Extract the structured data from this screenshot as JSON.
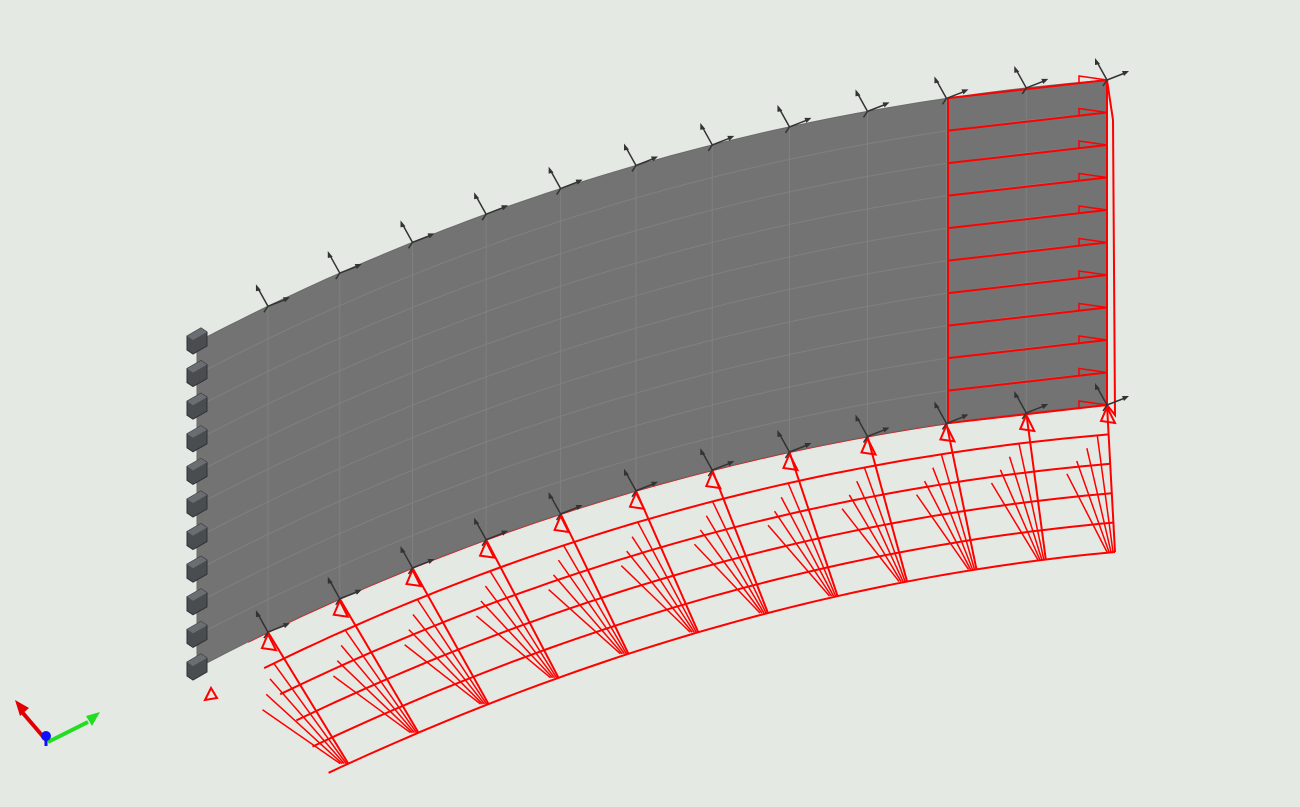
{
  "viewport": {
    "background": "#e5e9e4",
    "shell_color": "#737373",
    "shell_line_color": "#808080",
    "load_color": "#ff0000",
    "support_color": "#4a4d50",
    "triad_color": "#333333"
  },
  "model": {
    "shape": "curved-shell-panel",
    "rows": 10,
    "columns": 12,
    "support_count": 11,
    "loads": [
      "edge-load-red",
      "surface-pressure-red"
    ]
  },
  "triad": {
    "axes": [
      {
        "name": "x",
        "color": "#ff0000",
        "icon": "arrow-icon"
      },
      {
        "name": "y",
        "color": "#00cc00",
        "icon": "arrow-icon"
      },
      {
        "name": "z",
        "color": "#0000ff",
        "icon": "arrow-icon"
      }
    ]
  }
}
